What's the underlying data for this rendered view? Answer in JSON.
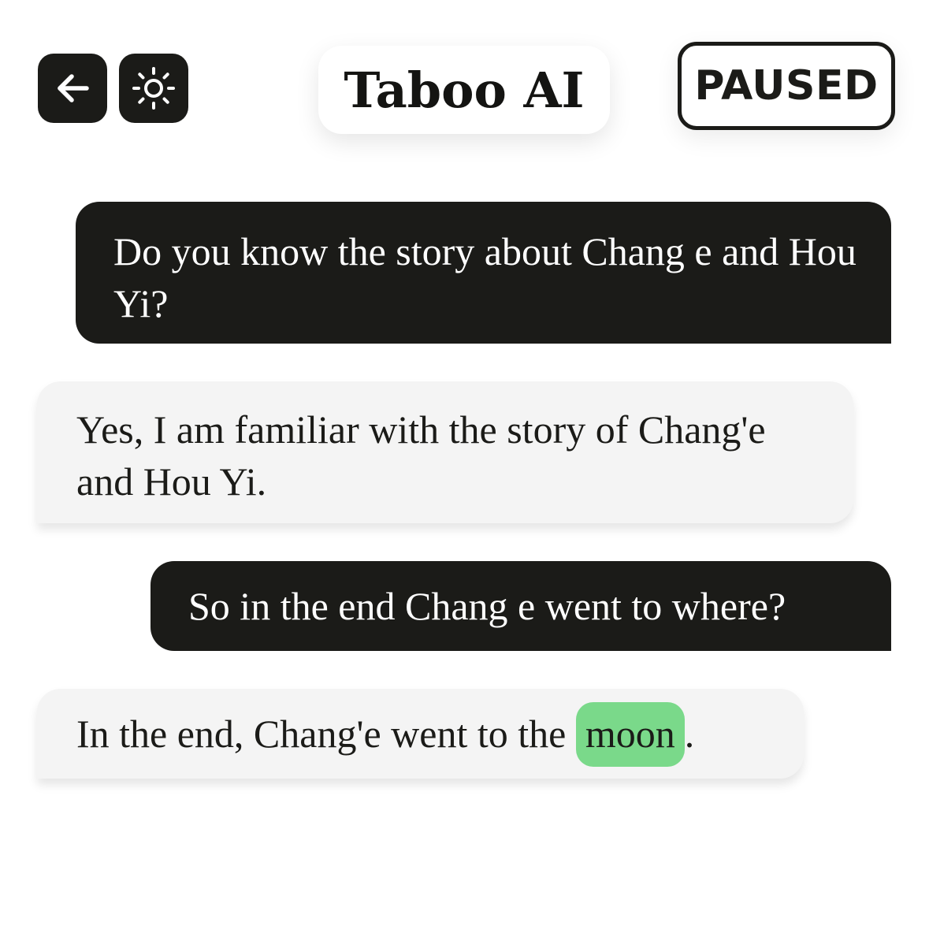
{
  "header": {
    "back_icon": "arrow-left-icon",
    "theme_icon": "sun-icon",
    "title": "Taboo AI",
    "status": "PAUSED"
  },
  "colors": {
    "dark": "#1b1b18",
    "bot_bubble": "#f4f4f4",
    "highlight": "#7ad98a"
  },
  "messages": [
    {
      "role": "user",
      "text": "Do you know the story about Chang e and Hou Yi?"
    },
    {
      "role": "assistant",
      "text": "Yes, I am familiar with the story of Chang'e and Hou Yi."
    },
    {
      "role": "user",
      "text": "So in the end Chang e went to where?"
    },
    {
      "role": "assistant",
      "text_before": "In the end, Chang'e went to the ",
      "highlight": "moon",
      "text_after": "."
    }
  ]
}
